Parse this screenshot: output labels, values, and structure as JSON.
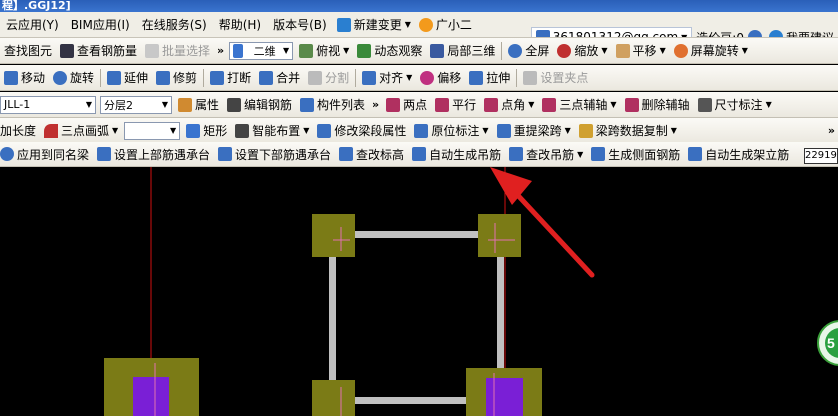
{
  "title": "程】.GGJ12]",
  "menu": [
    "云应用(Y)",
    "BIM应用(I)",
    "在线服务(S)",
    "帮助(H)",
    "版本号(B)"
  ],
  "menu_right": {
    "new_change": "新建变更",
    "assistant": "广小二",
    "account": "361801312@qq.com",
    "beans": "造价豆:0",
    "feedback": "我要建议"
  },
  "toolbar1": {
    "find": "查找图元",
    "view_rebar": "查看钢筋量",
    "batch": "批量选择",
    "view_mode": "二维",
    "top_view": "俯视",
    "dyn": "动态观察",
    "local3d": "局部三维",
    "fullscreen": "全屏",
    "zoom": "缩放",
    "pan": "平移",
    "rotate": "屏幕旋转"
  },
  "toolbar2": {
    "move": "移动",
    "rotate": "旋转",
    "extend": "延伸",
    "trim": "修剪",
    "break": "打断",
    "merge": "合并",
    "split": "分割",
    "align": "对齐",
    "offset": "偏移",
    "stretch": "拉伸",
    "setpoint": "设置夹点"
  },
  "toolbar3": {
    "member": "JLL-1",
    "layer": "分层2",
    "attr": "属性",
    "edit_rebar": "编辑钢筋",
    "member_list": "构件列表",
    "twopoint": "两点",
    "parallel": "平行",
    "pointangle": "点角",
    "threeaux": "三点辅轴",
    "delaux": "删除辅轴",
    "dim": "尺寸标注"
  },
  "toolbar4": {
    "length": "加长度",
    "arc": "三点画弧",
    "rect": "矩形",
    "smart": "智能布置",
    "modify_beam": "修改梁段属性",
    "orig_mark": "原位标注",
    "respan": "重提梁跨",
    "copy_span": "梁跨数据复制"
  },
  "toolbar5": {
    "apply_same": "应用到同名梁",
    "set_top": "设置上部筋遇承台",
    "set_bottom": "设置下部筋遇承台",
    "check_elev": "查改标高",
    "auto_hanger": "自动生成吊筋",
    "check_hanger": "查改吊筋",
    "side_rebar": "生成侧面钢筋",
    "auto_erect": "自动生成架立筋"
  },
  "coord": "22919",
  "colors": {
    "accent_arrow": "#e02020",
    "column_fill": "#7b7b16",
    "core_fill": "#7a1fd6",
    "beam": "#c0c0c0",
    "axis": "#d01010"
  }
}
